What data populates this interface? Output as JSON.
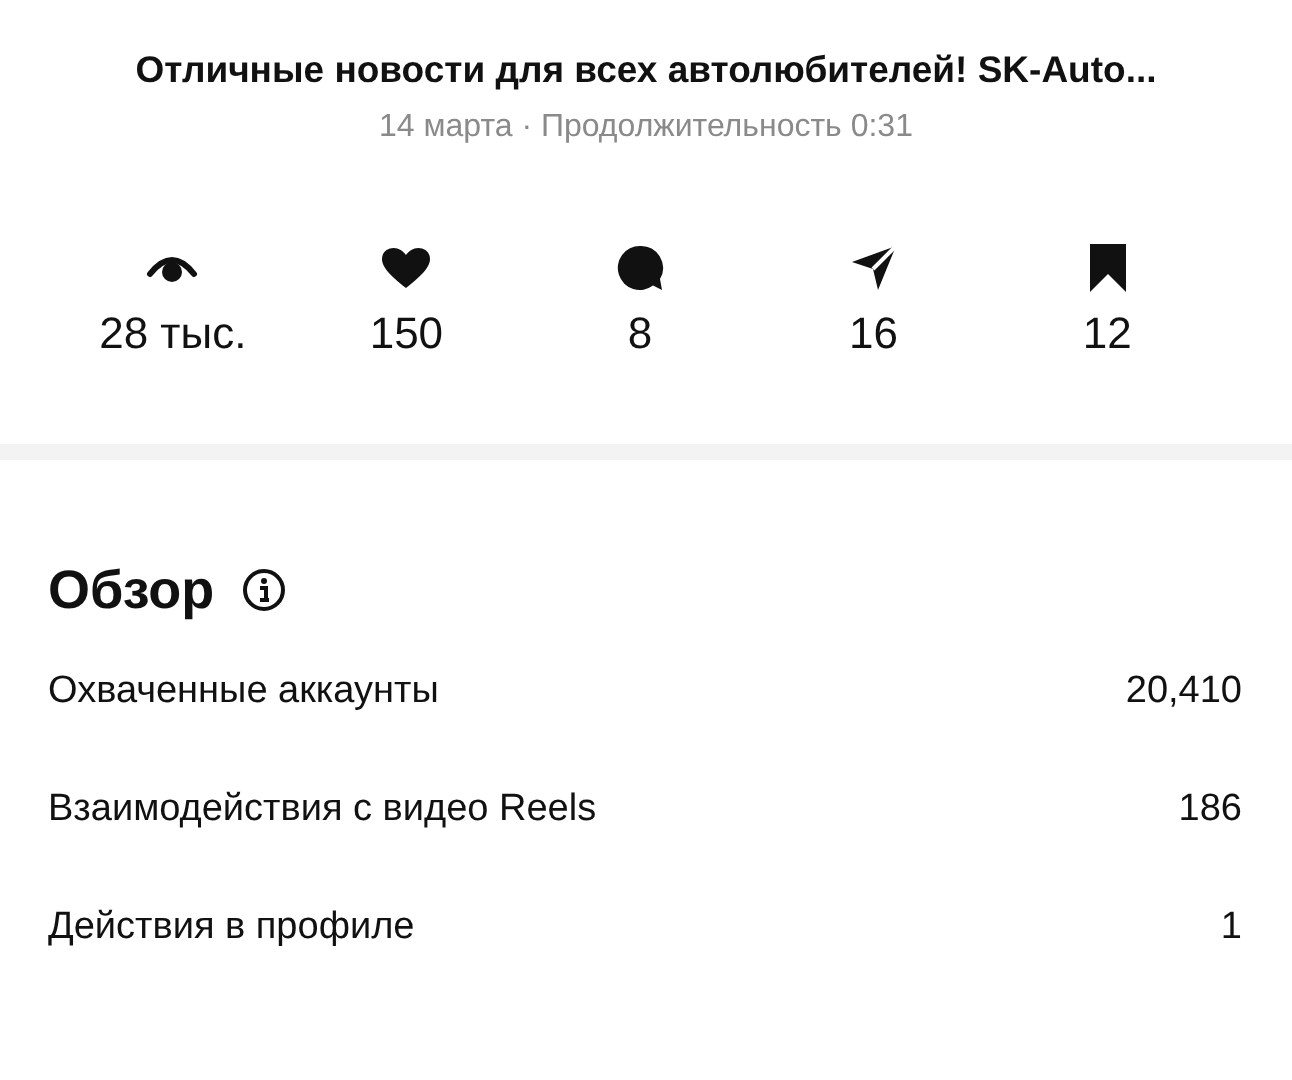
{
  "header": {
    "title": "Отличные новости для всех автолюбителей! SK-Auto...",
    "subtitle": "14 марта · Продолжительность 0:31"
  },
  "stats": [
    {
      "kind": "views",
      "value": "28 тыс."
    },
    {
      "kind": "likes",
      "value": "150"
    },
    {
      "kind": "comments",
      "value": "8"
    },
    {
      "kind": "shares",
      "value": "16"
    },
    {
      "kind": "saves",
      "value": "12"
    }
  ],
  "overview": {
    "title": "Обзор",
    "rows": [
      {
        "label": "Охваченные аккаунты",
        "value": "20,410"
      },
      {
        "label": "Взаимодействия с видео Reels",
        "value": "186"
      },
      {
        "label": "Действия в профиле",
        "value": "1"
      }
    ]
  }
}
